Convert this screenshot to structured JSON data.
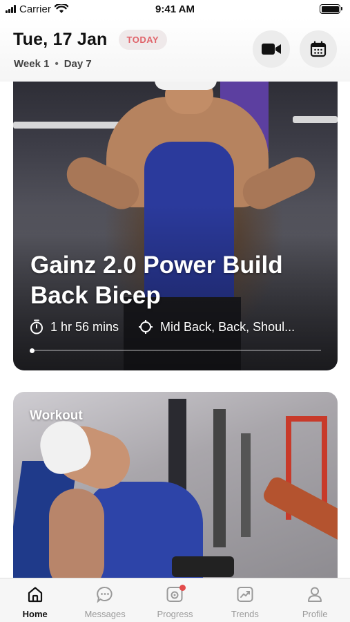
{
  "status_bar": {
    "carrier": "Carrier",
    "time": "9:41 AM"
  },
  "header": {
    "date": "Tue, 17 Jan",
    "today_badge": "TODAY",
    "week": "Week 1",
    "separator": "•",
    "day": "Day 7",
    "video_icon": "video-camera-icon",
    "calendar_icon": "calendar-icon"
  },
  "workout_card": {
    "title_line1": "Gainz 2.0 Power Build",
    "title_line2": "Back Bicep",
    "duration": "1 hr 56 mins",
    "targets": "Mid Back, Back, Shoul...",
    "duration_icon": "stopwatch-icon",
    "target_icon": "crosshair-icon",
    "progress": 0.0
  },
  "second_card": {
    "label": "Workout"
  },
  "tabs": [
    {
      "label": "Home",
      "icon": "home-icon",
      "active": true
    },
    {
      "label": "Messages",
      "icon": "chat-bubble-icon",
      "active": false
    },
    {
      "label": "Progress",
      "icon": "camera-icon",
      "active": false,
      "badge": true
    },
    {
      "label": "Trends",
      "icon": "trend-chart-icon",
      "active": false
    },
    {
      "label": "Profile",
      "icon": "person-icon",
      "active": false
    }
  ],
  "colors": {
    "badge_text": "#e0646b",
    "badge_bg": "#efe9ea",
    "notification_dot": "#e34b4b"
  }
}
